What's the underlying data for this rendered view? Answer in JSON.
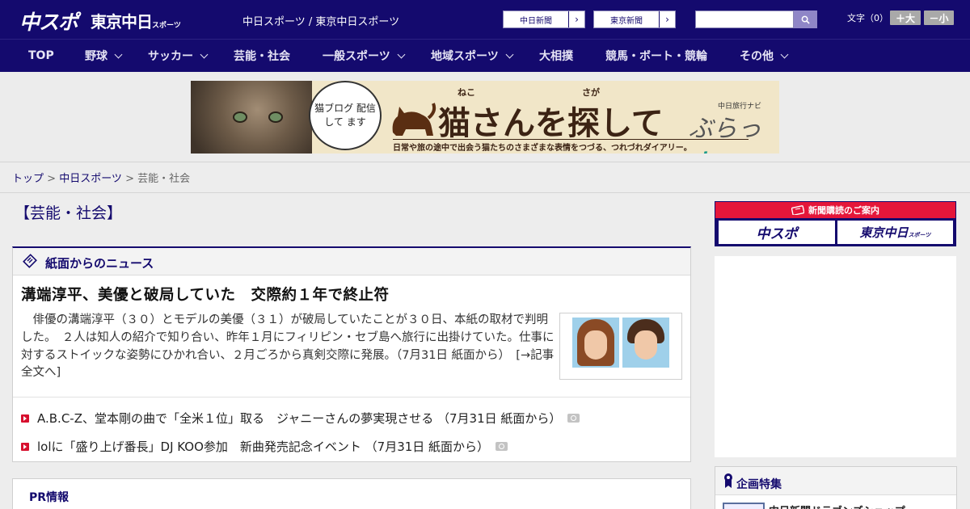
{
  "header": {
    "logo_main": "中スポ",
    "logo_tokyo": "東京中日",
    "logo_tokyo_suffix": "スポーツ",
    "site_names": "中日スポーツ / 東京中日スポーツ",
    "links": [
      {
        "label": "中日新聞",
        "arrow": "›"
      },
      {
        "label": "東京新聞",
        "arrow": "›"
      }
    ],
    "search": {
      "value": "",
      "placeholder": ""
    },
    "fontsize_label": "文字（0）",
    "fontsize_up": "＋大",
    "fontsize_down": "－小"
  },
  "nav": {
    "items": [
      {
        "label": "TOP",
        "has_menu": false
      },
      {
        "label": "野球",
        "has_menu": true
      },
      {
        "label": "サッカー",
        "has_menu": true
      },
      {
        "label": "芸能・社会",
        "has_menu": false
      },
      {
        "label": "一般スポーツ",
        "has_menu": true
      },
      {
        "label": "地域スポーツ",
        "has_menu": true
      },
      {
        "label": "大相撲",
        "has_menu": false
      },
      {
        "label": "競馬・ボート・競輪",
        "has_menu": false
      },
      {
        "label": "その他",
        "has_menu": true
      }
    ]
  },
  "banner": {
    "bubble_text": "猫ブログ 配信して ます",
    "ruby_neko": "ねこ",
    "ruby_saga": "さが",
    "title": "猫さんを探して",
    "navi_label": "中日旅行ナビ",
    "brand": "ぶらっ",
    "brand_jin": "人",
    "tagline": "日常や旅の途中で出会う猫たちのさまざまな表情をつづる、つれづれダイアリー。"
  },
  "breadcrumb": {
    "home": "トップ",
    "sep1": " > ",
    "section": "中日スポーツ",
    "sep2": " > ",
    "current": "芸能・社会"
  },
  "main": {
    "page_title": "【芸能・社会】",
    "news_section": {
      "title": "紙面からのニュース",
      "headline": "溝端淳平、美優と破局していた　交際約１年で終止符",
      "summary": "　俳優の溝端淳平（３０）とモデルの美優（３１）が破局していたことが３０日、本紙の取材で判明した。　２人は知人の紹介で知り合い、昨年１月にフィリピン・セブ島へ旅行に出掛けていた。仕事に対するストイックな姿勢にひかれ合い、２月ごろから真剣交際に発展。（7月31日 紙面から）　[→記事全文へ]",
      "list": [
        {
          "title": "A.B.C-Z、堂本剛の曲で「全米１位」取る　ジャニーさんの夢実現させる （7月31日 紙面から）"
        },
        {
          "title": "lolに「盛り上げ番長」DJ KOO参加　新曲発売記念イベント （7月31日 紙面から）"
        }
      ]
    },
    "pr_section": {
      "title": "PR情報"
    }
  },
  "sidebar": {
    "subscription_head": "新聞購読のご案内",
    "sub_buttons": [
      "中スポ",
      "東京中日"
    ],
    "sub_tokyo_suffix": "スポーツ",
    "special_title": "企画特集",
    "special_item": "中日新聞ドラゴンズショップ"
  },
  "colors": {
    "brand_navy": "#140a6e",
    "accent_red": "#e5163a",
    "background": "#ededed"
  }
}
